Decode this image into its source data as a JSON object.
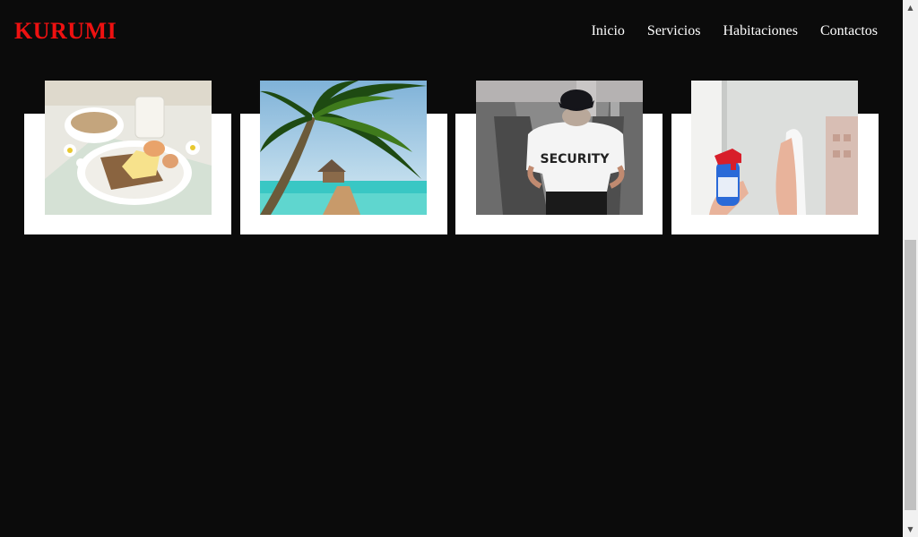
{
  "header": {
    "brand": "KURUMI",
    "nav": [
      "Inicio",
      "Servicios",
      "Habitaciones",
      "Contactos"
    ]
  },
  "services": [
    {
      "icon": "breakfast-photo"
    },
    {
      "icon": "beach-photo"
    },
    {
      "icon": "security-photo"
    },
    {
      "icon": "cleaning-photo"
    }
  ],
  "photo_text": {
    "security_shirt": "SECURITY"
  },
  "colors": {
    "background": "#0b0b0b",
    "brand": "#ee1111",
    "nav_text": "#ffffff",
    "card": "#ffffff"
  },
  "scrollbar": {
    "up_icon": "▲",
    "down_icon": "▼"
  }
}
